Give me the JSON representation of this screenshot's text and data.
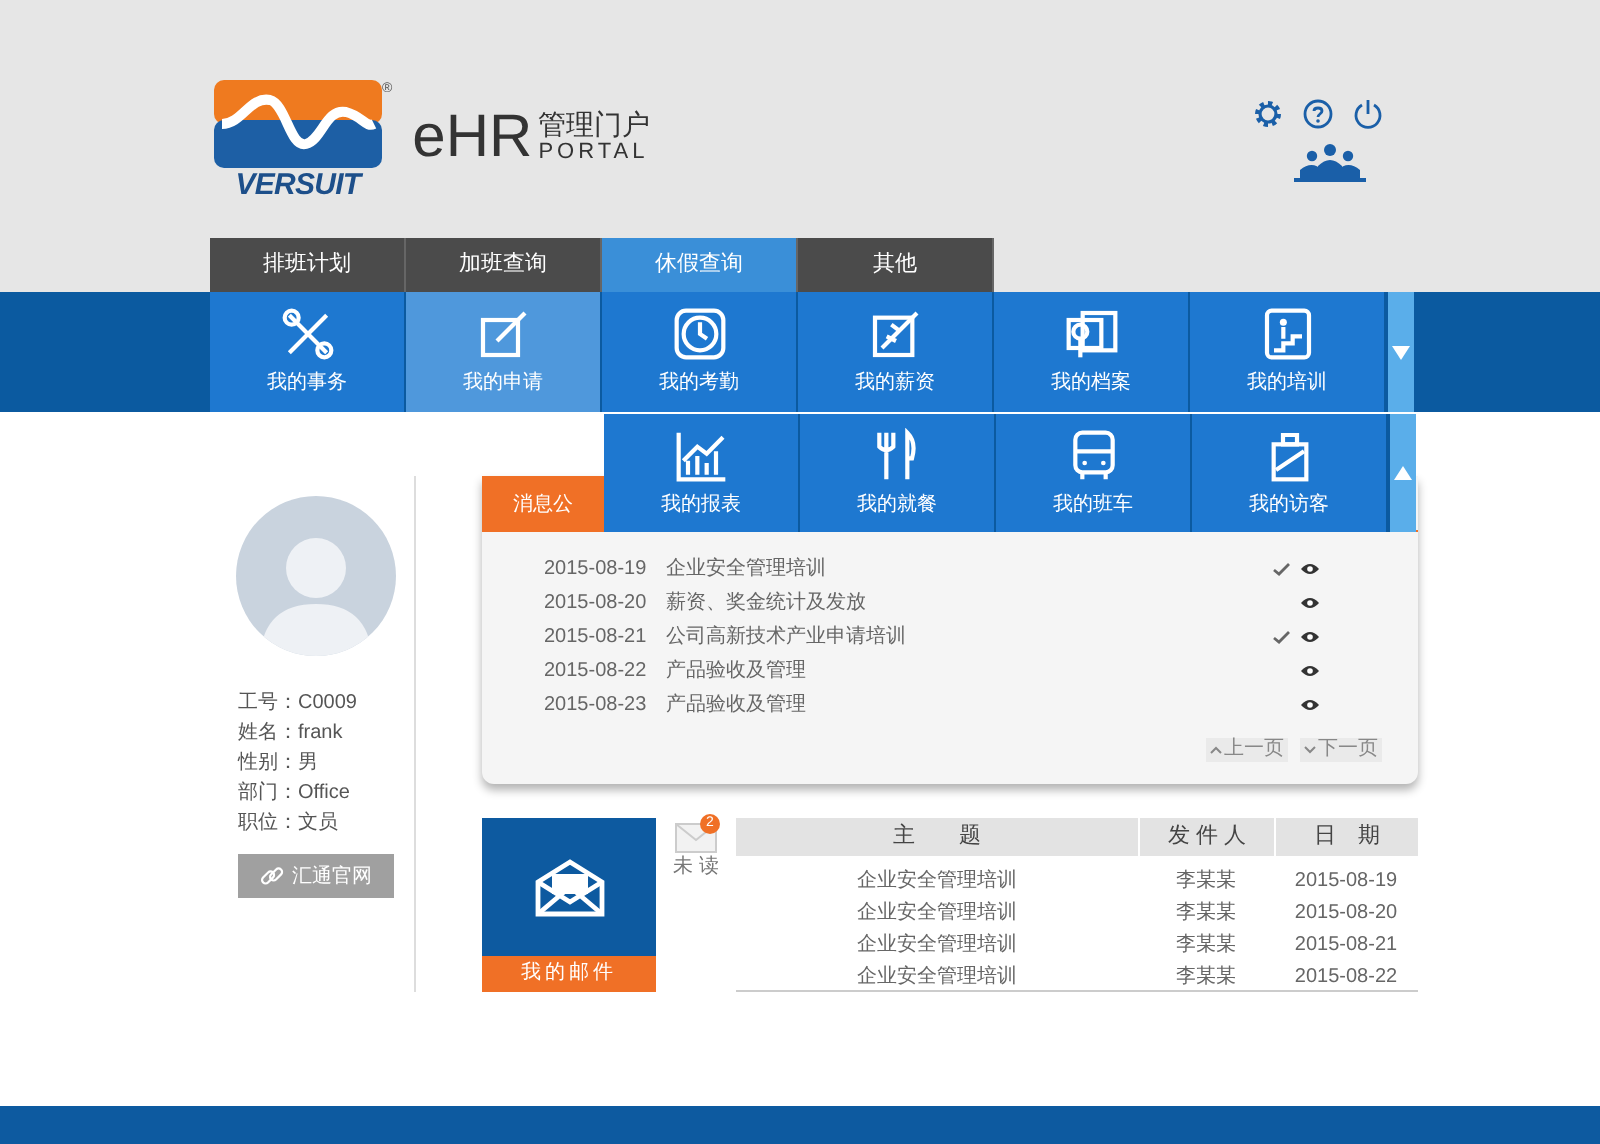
{
  "logo": {
    "brand": "VERSUIT",
    "mark": "®"
  },
  "title": {
    "main": "eHR",
    "cn": "管理门户",
    "en": "PORTAL"
  },
  "tabs": [
    {
      "label": "排班计划",
      "selected": false
    },
    {
      "label": "加班查询",
      "selected": false
    },
    {
      "label": "休假查询",
      "selected": true
    },
    {
      "label": "其他",
      "selected": false
    }
  ],
  "tiles": [
    {
      "label": "我的事务",
      "selected": false
    },
    {
      "label": "我的申请",
      "selected": true
    },
    {
      "label": "我的考勤",
      "selected": false
    },
    {
      "label": "我的薪资",
      "selected": false
    },
    {
      "label": "我的档案",
      "selected": false
    },
    {
      "label": "我的培训",
      "selected": false
    }
  ],
  "dropdown_tiles": [
    {
      "label": "我的报表",
      "selected": false
    },
    {
      "label": "我的就餐",
      "selected": false
    },
    {
      "label": "我的班车",
      "selected": false
    },
    {
      "label": "我的访客",
      "selected": false
    }
  ],
  "profile": {
    "lines": [
      "工号：C0009",
      "姓名：frank",
      "性别：男",
      "部门：Office",
      "职位：文员"
    ],
    "link": "汇通官网"
  },
  "notices": {
    "tab": "消息公",
    "rows": [
      {
        "date": "2015-08-19",
        "title": "企业安全管理培训",
        "checked": true
      },
      {
        "date": "2015-08-20",
        "title": "薪资、奖金统计及发放",
        "checked": false
      },
      {
        "date": "2015-08-21",
        "title": "公司高新技术产业申请培训",
        "checked": true
      },
      {
        "date": "2015-08-22",
        "title": "产品验收及管理",
        "checked": false
      },
      {
        "date": "2015-08-23",
        "title": "产品验收及管理",
        "checked": false
      }
    ],
    "prev": "上一页",
    "next": "下一页"
  },
  "mail": {
    "label": "我的邮件",
    "unread_count": "2",
    "unread_label": "未 读",
    "columns": [
      "主　　题",
      "发 件 人",
      "日　期"
    ],
    "rows": [
      [
        "企业安全管理培训",
        "李某某",
        "2015-08-19"
      ],
      [
        "企业安全管理培训",
        "李某某",
        "2015-08-20"
      ],
      [
        "企业安全管理培训",
        "李某某",
        "2015-08-21"
      ],
      [
        "企业安全管理培训",
        "李某某",
        "2015-08-22"
      ]
    ]
  }
}
